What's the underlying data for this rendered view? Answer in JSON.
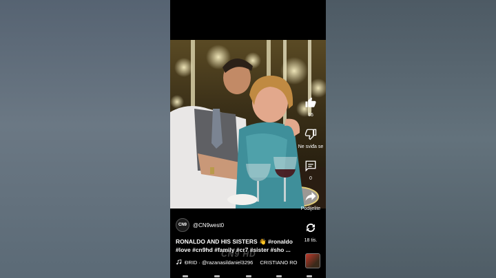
{
  "video": {
    "channel_avatar": "CN9",
    "channel_handle": "@CN9west0",
    "caption_title": "RONALDO AND HIS SISTERS 👋",
    "caption_tags_line1": "#ronaldo",
    "caption_tags_line2": "#love #cn9hd #family #cr7 #sister #sho ...",
    "watermark": "CN9 HD",
    "music_credit": "ÐRID · @razanasildaniel3296",
    "music_song": "CRISTIANO RO"
  },
  "actions": {
    "like_count": "15",
    "dislike_label": "Ne sviđa se",
    "comments_count": "0",
    "share_label": "Podijelite",
    "remix_count": "18 tis."
  },
  "colors": {
    "background": "#5d6b78",
    "screen": "#000000",
    "text": "#ffffff"
  },
  "icons": [
    "thumbs-up-icon",
    "thumbs-down-icon",
    "comment-icon",
    "share-icon",
    "remix-icon",
    "music-note-icon"
  ]
}
